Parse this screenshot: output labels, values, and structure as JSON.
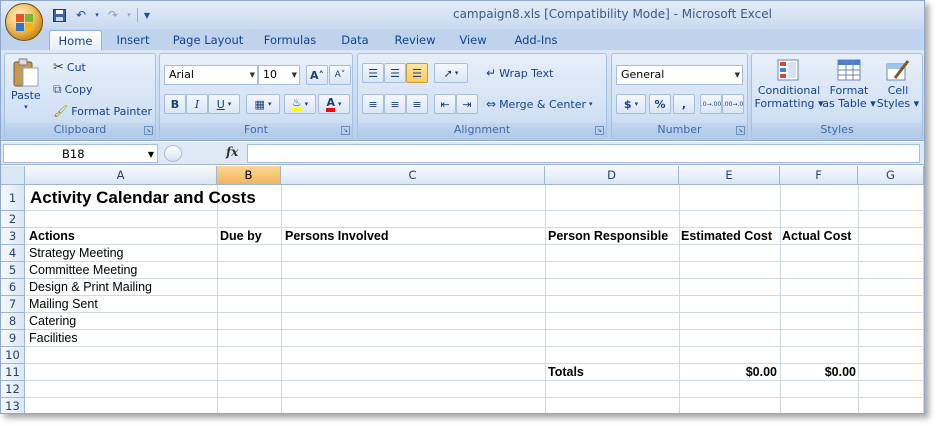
{
  "window": {
    "title": "campaign8.xls  [Compatibility Mode] - Microsoft Excel"
  },
  "tabs": [
    "Home",
    "Insert",
    "Page Layout",
    "Formulas",
    "Data",
    "Review",
    "View",
    "Add-Ins"
  ],
  "clipboard": {
    "label": "Clipboard",
    "paste": "Paste",
    "cut": "Cut",
    "copy": "Copy",
    "format_painter": "Format Painter"
  },
  "font": {
    "label": "Font",
    "name": "Arial",
    "size": "10",
    "bold": "B",
    "italic": "I",
    "underline": "U"
  },
  "alignment": {
    "label": "Alignment",
    "wrap_text": "Wrap Text",
    "merge_center": "Merge & Center"
  },
  "number": {
    "label": "Number",
    "format": "General",
    "currency": "$",
    "percent": "%",
    "comma": ",",
    "inc_decimal": ".0→.00",
    "dec_decimal": ".00→.0"
  },
  "styles": {
    "label": "Styles",
    "conditional": "Conditional",
    "conditional2": "Formatting",
    "format_table": "Format",
    "format_table2": "as Table",
    "cell_styles": "Cell",
    "cell_styles2": "Styles"
  },
  "formula_bar": {
    "name_box": "B18",
    "fx": "fx"
  },
  "columns": [
    "A",
    "B",
    "C",
    "D",
    "E",
    "F",
    "G"
  ],
  "rows": [
    "1",
    "2",
    "3",
    "4",
    "5",
    "6",
    "7",
    "8",
    "9",
    "10",
    "11",
    "12",
    "13"
  ],
  "sheet": {
    "title": "Activity Calendar and Costs",
    "headers": {
      "actions": "Actions",
      "due_by": "Due by",
      "persons": "Persons Involved",
      "responsible": "Person Responsible",
      "estimated": "Estimated Cost",
      "actual": "Actual Cost"
    },
    "actions": [
      "Strategy Meeting",
      "Committee Meeting",
      "Design & Print Mailing",
      "Mailing Sent",
      "Catering",
      "Facilities"
    ],
    "totals_label": "Totals",
    "estimated_total": "$0.00",
    "actual_total": "$0.00"
  },
  "colors": {
    "ribbon": "#c5d9f1",
    "selected_header": "#f4b45a",
    "grid_line": "#d0d7e5"
  }
}
